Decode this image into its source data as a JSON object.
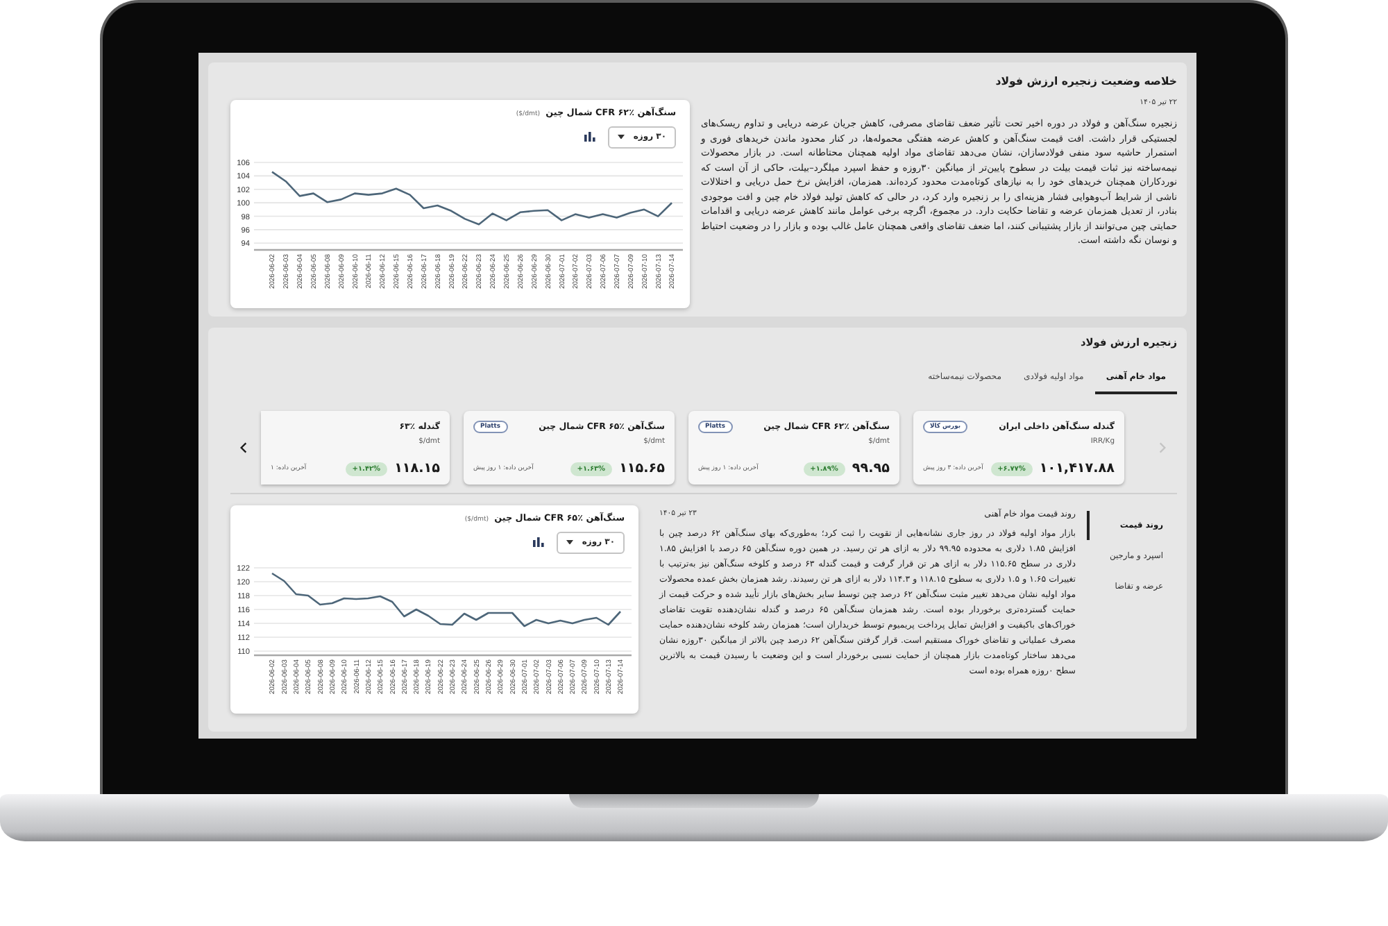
{
  "summary": {
    "title": "خلاصه وضعیت زنجیره ارزش فولاد",
    "date": "۲۲ تیر ۱۴۰۵",
    "text": "زنجیره سنگ‌آهن و فولاد در دوره اخیر تحت تأثیر ضعف تقاضای مصرفی، کاهش جریان عرضه دریایی و تداوم ریسک‌های لجستیکی قرار داشت. افت قیمت سنگ‌آهن و کاهش عرضه هفتگی محموله‌ها، در کنار محدود ماندن خریدهای فوری و استمرار حاشیه سود منفی فولادسازان، نشان می‌دهد تقاضای مواد اولیه همچنان محتاطانه است. در بازار محصولات نیمه‌ساخته نیز ثبات قیمت بیلت در سطوح پایین‌تر از میانگین ۳۰روزه و حفظ اسپرد میلگرد–بیلت، حاکی از آن است که نوردکاران همچنان خریدهای خود را به نیازهای کوتاه‌مدت محدود کرده‌اند. همزمان، افزایش نرخ حمل دریایی و اختلالات ناشی از شرایط آب‌وهوایی فشار هزینه‌ای را بر زنجیره وارد کرد، در حالی که کاهش تولید فولاد خام چین و افت موجودی بنادر، از تعدیل همزمان عرضه و تقاضا حکایت دارد. در مجموع، اگرچه برخی عوامل مانند کاهش عرضه دریایی و اقدامات حمایتی چین می‌توانند از بازار پشتیبانی کنند، اما ضعف تقاضای واقعی همچنان عامل غالب بوده و بازار را در وضعیت احتیاط و نوسان نگه داشته است.",
    "chart": {
      "unit": "($/dmt)",
      "range": "۳۰ روزه",
      "chart_data": {
        "type": "line",
        "title": "سنگ‌آهن ٪۶۲ CFR شمال چین",
        "x": [
          "2026-06-02",
          "2026-06-03",
          "2026-06-04",
          "2026-06-05",
          "2026-06-08",
          "2026-06-09",
          "2026-06-10",
          "2026-06-11",
          "2026-06-12",
          "2026-06-15",
          "2026-06-16",
          "2026-06-17",
          "2026-06-18",
          "2026-06-19",
          "2026-06-22",
          "2026-06-23",
          "2026-06-24",
          "2026-06-25",
          "2026-06-26",
          "2026-06-29",
          "2026-06-30",
          "2026-07-01",
          "2026-07-02",
          "2026-07-03",
          "2026-07-06",
          "2026-07-07",
          "2026-07-09",
          "2026-07-10",
          "2026-07-13",
          "2026-07-14"
        ],
        "series": [
          {
            "color": "#4d6679",
            "values": [
              104.6,
              103.2,
              101.0,
              101.4,
              100.1,
              100.5,
              101.4,
              101.2,
              101.4,
              102.1,
              101.2,
              99.2,
              99.6,
              98.8,
              97.6,
              96.8,
              98.4,
              97.4,
              98.6,
              98.8,
              98.9,
              97.4,
              98.3,
              97.8,
              98.3,
              97.8,
              98.5,
              99.0,
              98.0,
              100.0
            ]
          }
        ],
        "ylim": [
          93,
          106
        ],
        "yticks": [
          94,
          96,
          98,
          100,
          102,
          104,
          106
        ],
        "grid": true
      }
    }
  },
  "chain": {
    "title": "زنجیره ارزش فولاد",
    "tabs": [
      {
        "label": "مواد خام آهنی",
        "selected": true
      },
      {
        "label": "مواد اولیه فولادی",
        "selected": false
      },
      {
        "label": "محصولات نیمه‌ساخته",
        "selected": false
      }
    ],
    "arrows": [
      {
        "kind": "right",
        "disabled": true
      },
      {
        "kind": "left",
        "disabled": false
      }
    ],
    "cards": [
      {
        "title": "گندله سنگ‌آهن داخلی ایران",
        "source": "بورس کالا",
        "unit": "IRR/Kg",
        "value": "۱۰۱,۴۱۷.۸۸",
        "change": "+۶.۷۷%",
        "updated": "آخرین داده: ۳ روز پیش"
      },
      {
        "title": "سنگ‌آهن ٪۶۲ CFR شمال چین",
        "source": "Platts",
        "unit": "$/dmt",
        "value": "۹۹.۹۵",
        "change": "+۱.۸۹%",
        "updated": "آخرین داده: ۱ روز پیش"
      },
      {
        "title": "سنگ‌آهن ٪۶۵ CFR شمال چین",
        "source": "Platts",
        "unit": "$/dmt",
        "value": "۱۱۵.۶۵",
        "change": "+۱.۶۳%",
        "updated": "آخرین داده: ۱ روز پیش"
      },
      {
        "title": "گندله ٪۶۳",
        "unit": "$/dmt",
        "value": "۱۱۸.۱۵",
        "change": "+۱.۴۲%",
        "updated": "آخرین داده: ۱"
      }
    ],
    "detail": {
      "nav": [
        {
          "label": "روند قیمت",
          "selected": true
        },
        {
          "label": "اسپرد و مارجین",
          "selected": false
        },
        {
          "label": "عرضه و تقاضا",
          "selected": false
        }
      ],
      "heading": "روند قیمت مواد خام آهنی",
      "date": "۲۳ تیر ۱۴۰۵",
      "text": "بازار مواد اولیه فولاد در روز جاری نشانه‌هایی از تقویت را ثبت کرد؛ به‌طوری‌که بهای سنگ‌آهن ۶۲ درصد چین با افزایش ۱.۸۵ دلاری به محدوده ۹۹.۹۵ دلار به ازای هر تن رسید. در همین دوره سنگ‌آهن ۶۵ درصد با افزایش ۱.۸۵ دلاری در سطح ۱۱۵.۶۵ دلار به ازای هر تن قرار گرفت و قیمت گندله ۶۳ درصد و کلوخه سنگ‌آهن نیز به‌ترتیب با تغییرات ۱.۶۵ و ۱.۵ دلاری به سطوح ۱۱۸.۱۵ و ۱۱۴.۳ دلار به ازای هر تن رسیدند. رشد همزمان بخش عمده محصولات مواد اولیه نشان می‌دهد تغییر مثبت سنگ‌آهن ۶۲ درصد چین توسط سایر بخش‌های بازار تأیید شده و حرکت قیمت از حمایت گسترده‌تری برخوردار بوده است. رشد همزمان سنگ‌آهن ۶۵ درصد و گندله نشان‌دهنده تقویت تقاضای خوراک‌های باکیفیت و افزایش تمایل پرداخت پریمیوم توسط خریداران است؛ همزمان رشد کلوخه نشان‌دهنده حمایت مصرف عملیاتی و تقاضای خوراک مستقیم است. قرار گرفتن سنگ‌آهن ۶۲ درصد چین بالاتر از میانگین ۳۰روزه نشان می‌دهد ساختار کوتاه‌مدت بازار همچنان از حمایت نسبی برخوردار است و این وضعیت با رسیدن قیمت به بالاترین سطح ۰روزه همراه بوده است",
      "chart": {
        "unit": "($/dmt)",
        "range": "۳۰ روزه",
        "chart_data": {
          "type": "line",
          "title": "سنگ‌آهن ٪۶۵ CFR شمال چین",
          "x": [
            "2026-06-02",
            "2026-06-03",
            "2026-06-04",
            "2026-06-05",
            "2026-06-08",
            "2026-06-09",
            "2026-06-10",
            "2026-06-11",
            "2026-06-12",
            "2026-06-15",
            "2026-06-16",
            "2026-06-17",
            "2026-06-18",
            "2026-06-19",
            "2026-06-22",
            "2026-06-23",
            "2026-06-24",
            "2026-06-25",
            "2026-06-26",
            "2026-06-29",
            "2026-06-30",
            "2026-07-01",
            "2026-07-02",
            "2026-07-03",
            "2026-07-06",
            "2026-07-07",
            "2026-07-09",
            "2026-07-10",
            "2026-07-13",
            "2026-07-14"
          ],
          "series": [
            {
              "color": "#4d6679",
              "values": [
                121.2,
                120.1,
                118.2,
                118.0,
                116.7,
                116.9,
                117.6,
                117.5,
                117.6,
                117.9,
                117.1,
                115.0,
                116.0,
                115.1,
                113.9,
                113.8,
                115.4,
                114.5,
                115.5,
                115.5,
                115.5,
                113.6,
                114.5,
                114.0,
                114.4,
                114.0,
                114.5,
                114.8,
                113.8,
                115.7
              ]
            }
          ],
          "ylim": [
            109.4,
            122
          ],
          "yticks": [
            110,
            112,
            114,
            116,
            118,
            120,
            122
          ],
          "grid": true
        }
      }
    }
  }
}
